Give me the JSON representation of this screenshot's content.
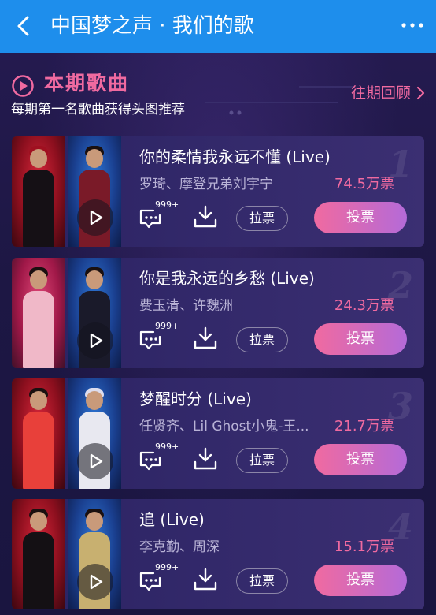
{
  "navbar": {
    "back_icon": "chevron-left-icon",
    "title": "中国梦之声 · 我们的歌",
    "more_icon": "more-dots-icon",
    "bg_color": "#1e8eec"
  },
  "section": {
    "icon": "play-circle-icon",
    "title": "本期歌曲",
    "subtitle": "每期第一名歌曲获得头图推荐",
    "history_link": "往期回顾",
    "history_icon": "chevron-right-icon",
    "accent_color": "#f06aa0"
  },
  "songs": [
    {
      "rank": "1",
      "title": "你的柔情我永远不懂 (Live)",
      "artists": "罗琦、摩登兄弟刘宇宁",
      "votes": "74.5万票",
      "comment_count": "999+",
      "lapiao_label": "拉票",
      "vote_label": "投票"
    },
    {
      "rank": "2",
      "title": "你是我永远的乡愁 (Live)",
      "artists": "费玉清、许魏洲",
      "votes": "24.3万票",
      "comment_count": "999+",
      "lapiao_label": "拉票",
      "vote_label": "投票"
    },
    {
      "rank": "3",
      "title": "梦醒时分 (Live)",
      "artists": "任贤齐、Lil Ghost小鬼-王...",
      "votes": "21.7万票",
      "comment_count": "999+",
      "lapiao_label": "拉票",
      "vote_label": "投票"
    },
    {
      "rank": "4",
      "title": "追 (Live)",
      "artists": "李克勤、周深",
      "votes": "15.1万票",
      "comment_count": "999+",
      "lapiao_label": "拉票",
      "vote_label": "投票"
    }
  ]
}
